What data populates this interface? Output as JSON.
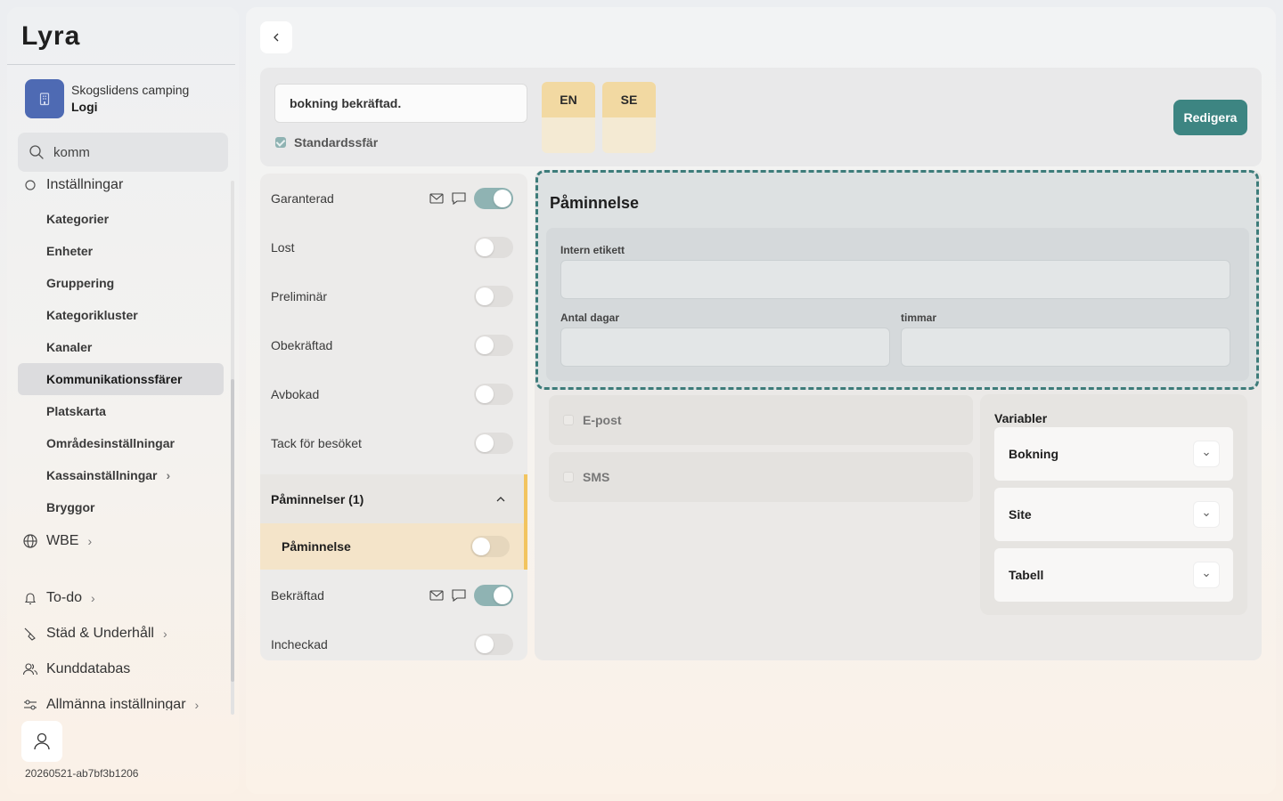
{
  "app": {
    "logo_text": "Lyra"
  },
  "org": {
    "name": "Skogslidens camping",
    "section": "Logi"
  },
  "search": {
    "value": "komm"
  },
  "sidebar": {
    "partial_item": "Inställningar",
    "sub_items": [
      {
        "label": "Kategorier"
      },
      {
        "label": "Enheter"
      },
      {
        "label": "Gruppering"
      },
      {
        "label": "Kategorikluster"
      },
      {
        "label": "Kanaler"
      },
      {
        "label": "Kommunikationssfärer",
        "active": true
      },
      {
        "label": "Platskarta"
      },
      {
        "label": "Områdesinställningar"
      },
      {
        "label": "Kassainställningar",
        "has_children": true
      },
      {
        "label": "Bryggor"
      }
    ],
    "main_items": [
      {
        "label": "WBE",
        "icon": "globe-icon"
      },
      {
        "label": "To-do",
        "icon": "bell-icon"
      },
      {
        "label": "Städ & Underhåll",
        "icon": "broom-icon"
      },
      {
        "label": "Kunddatabas",
        "icon": "users-icon"
      },
      {
        "label": "Allmänna inställningar",
        "icon": "sliders-icon"
      }
    ],
    "version": "20260521-ab7bf3b1206"
  },
  "toolbar": {
    "name_value": "bokning bekräftad.",
    "default_sphere_label": "Standardssfär",
    "default_sphere_checked": true,
    "languages": [
      {
        "code": "EN",
        "enabled": true
      },
      {
        "code": "SE",
        "enabled": true
      }
    ],
    "edit_label": "Redigera"
  },
  "statuses": [
    {
      "label": "Garanterad",
      "enabled": true,
      "email": true,
      "sms": true
    },
    {
      "label": "Lost",
      "enabled": false
    },
    {
      "label": "Preliminär",
      "enabled": false
    },
    {
      "label": "Obekräftad",
      "enabled": false
    },
    {
      "label": "Avbokad",
      "enabled": false
    },
    {
      "label": "Tack för besöket",
      "enabled": false
    },
    {
      "label": "Påminnelser (1)",
      "group": true,
      "expanded": true
    },
    {
      "label": "Påminnelse",
      "enabled": false,
      "selected": true
    },
    {
      "label": "Bekräftad",
      "enabled": true,
      "email": true,
      "sms": true
    },
    {
      "label": "Incheckad",
      "enabled": false
    }
  ],
  "reminder": {
    "title": "Påminnelse",
    "internal_label": "Intern etikett",
    "internal_value": "",
    "days_label": "Antal dagar",
    "days_value": "",
    "hours_label": "timmar",
    "hours_value": ""
  },
  "channels": [
    {
      "label": "E-post",
      "checked": false
    },
    {
      "label": "SMS",
      "checked": false
    }
  ],
  "variables": {
    "title": "Variabler",
    "items": [
      {
        "label": "Bokning"
      },
      {
        "label": "Site"
      },
      {
        "label": "Tabell"
      }
    ]
  },
  "colors": {
    "accent": "#3d8582",
    "brand_icon": "#4e6ab3",
    "selected_highlight": "#f4e4c9",
    "selected_bar": "#f2c45f"
  }
}
